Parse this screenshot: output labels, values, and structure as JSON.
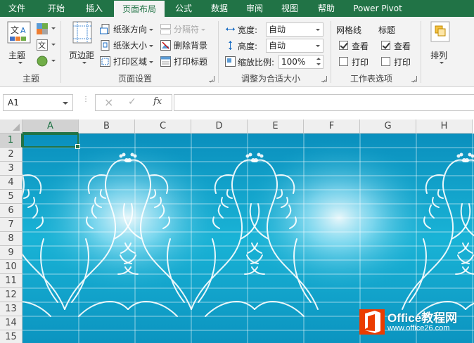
{
  "tabs": [
    {
      "label": "文件",
      "active": false
    },
    {
      "label": "开始",
      "active": false
    },
    {
      "label": "插入",
      "active": false
    },
    {
      "label": "页面布局",
      "active": true
    },
    {
      "label": "公式",
      "active": false
    },
    {
      "label": "数据",
      "active": false
    },
    {
      "label": "审阅",
      "active": false
    },
    {
      "label": "视图",
      "active": false
    },
    {
      "label": "帮助",
      "active": false
    },
    {
      "label": "Power Pivot",
      "active": false
    }
  ],
  "ribbon": {
    "theme_group": {
      "label": "主题",
      "themes_button": "主题",
      "colors_icon": "theme-colors-icon",
      "fonts_icon": "theme-fonts-icon",
      "effects_icon": "theme-effects-icon"
    },
    "page_setup_group": {
      "label": "页面设置",
      "margins": "页边距",
      "orientation": "纸张方向",
      "size": "纸张大小",
      "print_area": "打印区域",
      "breaks": "分隔符",
      "background": "删除背景",
      "print_titles": "打印标题"
    },
    "scale_group": {
      "label": "调整为合适大小",
      "width_label": "宽度:",
      "width_value": "自动",
      "height_label": "高度:",
      "height_value": "自动",
      "scale_label": "缩放比例:",
      "scale_value": "100%"
    },
    "sheet_options_group": {
      "label": "工作表选项",
      "gridlines_label": "网格线",
      "gridlines_view": "查看",
      "gridlines_view_checked": true,
      "gridlines_print": "打印",
      "gridlines_print_checked": false,
      "headings_label": "标题",
      "headings_view": "查看",
      "headings_view_checked": true,
      "headings_print": "打印",
      "headings_print_checked": false
    },
    "arrange_group": {
      "label": "排列"
    }
  },
  "formula_bar": {
    "name_box": "A1",
    "cancel_icon": "×",
    "enter_icon": "✓",
    "fx": "fx",
    "formula": ""
  },
  "sheet": {
    "columns": [
      "A",
      "B",
      "C",
      "D",
      "E",
      "F",
      "G",
      "H"
    ],
    "rows": [
      "1",
      "2",
      "3",
      "4",
      "5",
      "6",
      "7",
      "8",
      "9",
      "10",
      "11",
      "12",
      "13",
      "14",
      "15"
    ],
    "selected_cell": "A1",
    "background_color": "#12a6cc"
  },
  "watermark": {
    "line1": "Office教程网",
    "line2": "www.office26.com"
  },
  "colors": {
    "accent": "#217346",
    "tab_bar": "#217346",
    "ribbon": "#f3f3f3",
    "watermark_logo": "#eb3c00"
  }
}
